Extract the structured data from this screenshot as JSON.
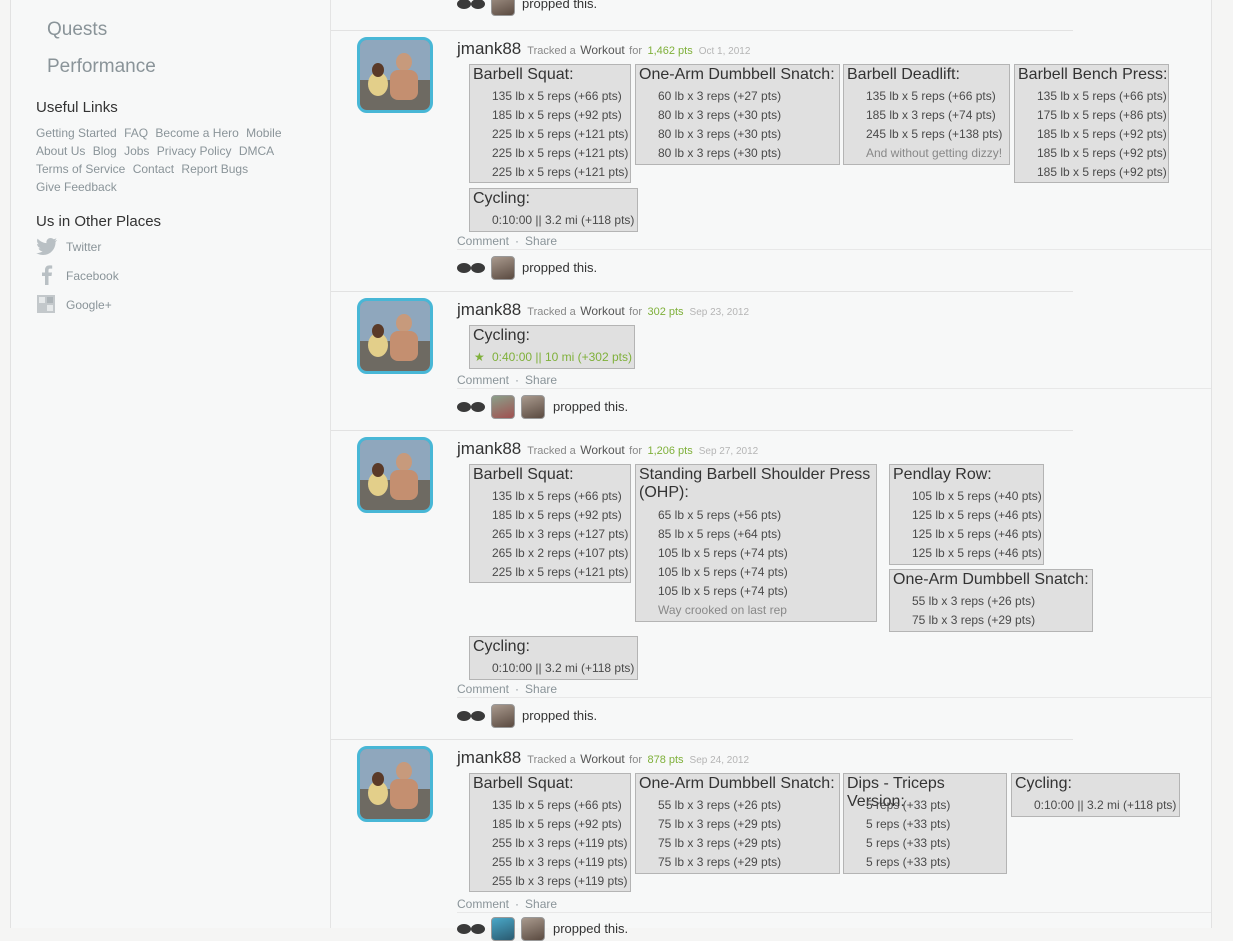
{
  "sidebar": {
    "nav": [
      "Quests",
      "Performance"
    ],
    "useful_links_heading": "Useful Links",
    "links_rows": [
      [
        "Getting Started",
        "FAQ",
        "Become a Hero",
        "Mobile"
      ],
      [
        "About Us",
        "Blog",
        "Jobs",
        "Privacy Policy",
        "DMCA"
      ],
      [
        "Terms of Service",
        "Contact",
        "Report Bugs"
      ],
      [
        "Give Feedback"
      ]
    ],
    "other_places_heading": "Us in Other Places",
    "social": [
      {
        "label": "Twitter",
        "icon": "twitter-icon"
      },
      {
        "label": "Facebook",
        "icon": "facebook-icon"
      },
      {
        "label": "Google+",
        "icon": "google-plus-icon"
      }
    ]
  },
  "feed": {
    "top_propped": "propped this.",
    "tracked_prefix": "Tracked a",
    "workout_word": "Workout",
    "for_word": "for",
    "comment_label": "Comment",
    "share_label": "Share",
    "separator": "·",
    "propped_text": "propped this.",
    "entries": [
      {
        "user": "jmank88",
        "points": "1,462 pts",
        "date": "Oct 1, 2012",
        "exercises": [
          {
            "title": "Barbell Squat:",
            "rows": [
              "135 lb x 5 reps (+66 pts)",
              "185 lb x 5 reps (+92 pts)",
              "225 lb x 5 reps (+121 pts)",
              "225 lb x 5 reps (+121 pts)",
              "225 lb x 5 reps (+121 pts)"
            ]
          },
          {
            "title": "One-Arm Dumbbell Snatch:",
            "rows": [
              "60 lb x 3 reps (+27 pts)",
              "80 lb x 3 reps (+30 pts)",
              "80 lb x 3 reps (+30 pts)",
              "80 lb x 3 reps (+30 pts)"
            ]
          },
          {
            "title": "Barbell Deadlift:",
            "rows": [
              "135 lb x 5 reps (+66 pts)",
              "185 lb x 3 reps (+74 pts)",
              "245 lb x 5 reps (+138 pts)"
            ],
            "note": "And without getting dizzy!"
          },
          {
            "title": "Barbell Bench Press:",
            "rows": [
              "135 lb x 5 reps (+66 pts)",
              "175 lb x 5 reps (+86 pts)",
              "185 lb x 5 reps (+92 pts)",
              "185 lb x 5 reps (+92 pts)",
              "185 lb x 5 reps (+92 pts)"
            ]
          },
          {
            "title": "Cycling:",
            "rows": [
              "0:10:00 || 3.2 mi (+118 pts)"
            ]
          }
        ]
      },
      {
        "user": "jmank88",
        "points": "302 pts",
        "date": "Sep 23, 2012",
        "exercises": [
          {
            "title": "Cycling:",
            "star": "★",
            "rows": [
              "0:40:00 || 10 mi (+302 pts)"
            ]
          }
        ]
      },
      {
        "user": "jmank88",
        "points": "1,206 pts",
        "date": "Sep 27, 2012",
        "exercises": [
          {
            "title": "Barbell Squat:",
            "rows": [
              "135 lb x 5 reps (+66 pts)",
              "185 lb x 5 reps (+92 pts)",
              "265 lb x 3 reps (+127 pts)",
              "265 lb x 2 reps (+107 pts)",
              "225 lb x 5 reps (+121 pts)"
            ]
          },
          {
            "title_lines": [
              "Standing Barbell Shoulder Press",
              "(OHP):"
            ],
            "rows": [
              "65 lb x 5 reps (+56 pts)",
              "85 lb x 5 reps (+64 pts)",
              "105 lb x 5 reps (+74 pts)",
              "105 lb x 5 reps (+74 pts)",
              "105 lb x 5 reps (+74 pts)"
            ],
            "note": "Way crooked on last rep"
          },
          {
            "title": "Pendlay Row:",
            "rows": [
              "105 lb x 5 reps (+40 pts)",
              "125 lb x 5 reps (+46 pts)",
              "125 lb x 5 reps (+46 pts)",
              "125 lb x 5 reps (+46 pts)"
            ]
          },
          {
            "title": "One-Arm Dumbbell Snatch:",
            "rows": [
              "55 lb x 3 reps (+26 pts)",
              "75 lb x 3 reps (+29 pts)"
            ]
          },
          {
            "title": "Cycling:",
            "rows": [
              "0:10:00 || 3.2 mi (+118 pts)"
            ]
          }
        ]
      },
      {
        "user": "jmank88",
        "points": "878 pts",
        "date": "Sep 24, 2012",
        "exercises": [
          {
            "title": "Barbell Squat:",
            "rows": [
              "135 lb x 5 reps (+66 pts)",
              "185 lb x 5 reps (+92 pts)",
              "255 lb x 3 reps (+119 pts)",
              "255 lb x 3 reps (+119 pts)",
              "255 lb x 3 reps (+119 pts)"
            ]
          },
          {
            "title": "One-Arm Dumbbell Snatch:",
            "rows": [
              "55 lb x 3 reps (+26 pts)",
              "75 lb x 3 reps (+29 pts)",
              "75 lb x 3 reps (+29 pts)",
              "75 lb x 3 reps (+29 pts)"
            ]
          },
          {
            "title": "Dips - Triceps Version:",
            "rows": [
              "5 reps (+33 pts)",
              "5 reps (+33 pts)",
              "5 reps (+33 pts)",
              "5 reps (+33 pts)"
            ]
          },
          {
            "title": "Cycling:",
            "rows": [
              "0:10:00 || 3.2 mi (+118 pts)"
            ]
          }
        ]
      }
    ]
  }
}
